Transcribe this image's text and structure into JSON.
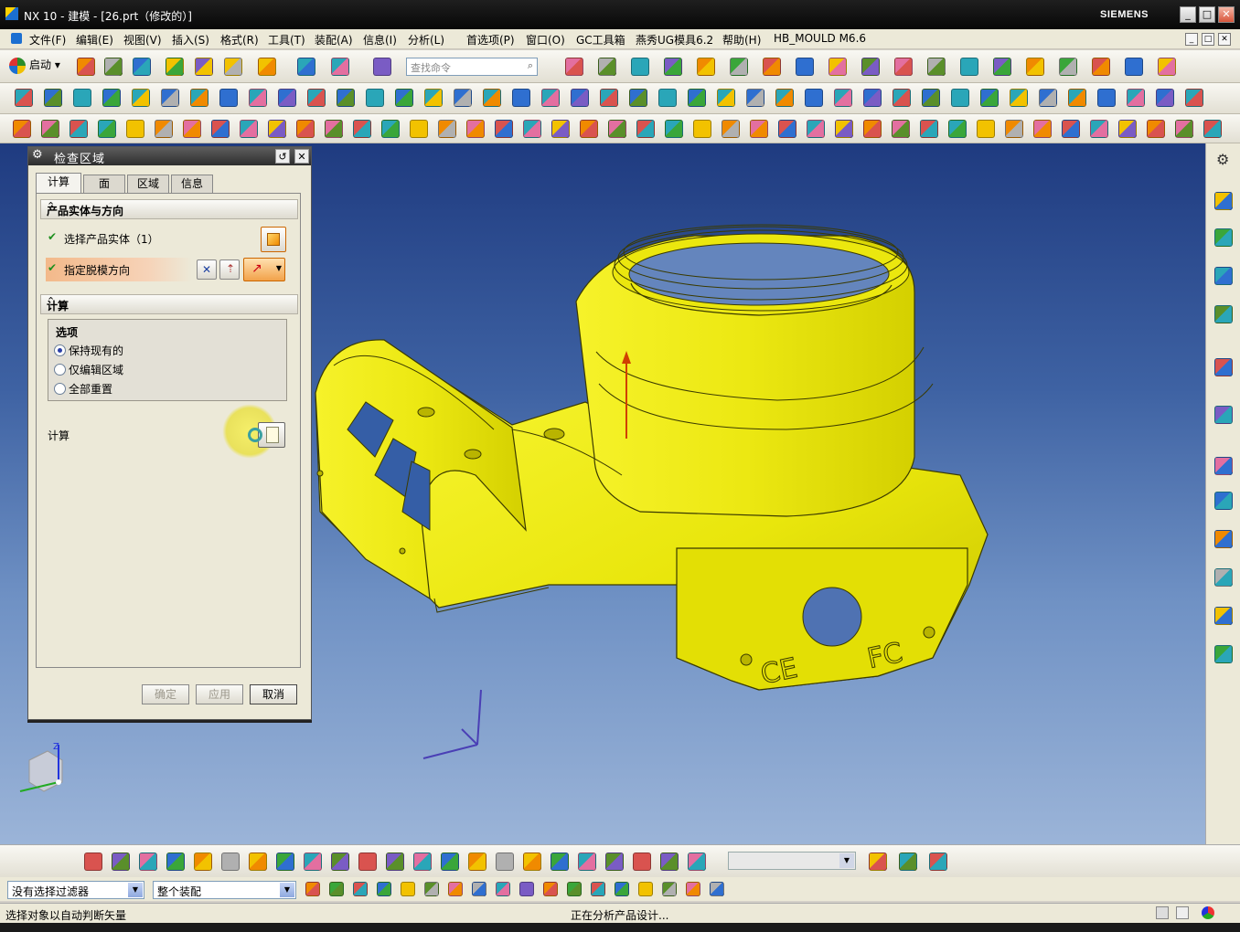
{
  "window": {
    "title": "NX 10 - 建模 - [26.prt（修改的）]",
    "brand": "SIEMENS",
    "controls": [
      "_",
      "□",
      "✕"
    ]
  },
  "menu": {
    "items": [
      "文件(F)",
      "编辑(E)",
      "视图(V)",
      "插入(S)",
      "格式(R)",
      "工具(T)",
      "装配(A)",
      "信息(I)",
      "分析(L)",
      "首选项(P)",
      "窗口(O)",
      "GC工具箱",
      "燕秀UG模具6.2",
      "帮助(H)",
      "HB_MOULD M6.6"
    ]
  },
  "toolbar": {
    "start_label": "启动",
    "search_placeholder": "查找命令"
  },
  "dialog": {
    "title": "检查区域",
    "tabs": [
      "计算",
      "面",
      "区域",
      "信息"
    ],
    "active_tab": "计算",
    "group_product": "产品实体与方向",
    "select_body": "选择产品实体（1）",
    "draft_direction": "指定脱模方向",
    "group_calc": "计算",
    "options_title": "选项",
    "options": [
      "保持现有的",
      "仅编辑区域",
      "全部重置"
    ],
    "selected_option": "保持现有的",
    "calc_label": "计算",
    "ok": "确定",
    "apply": "应用",
    "cancel": "取消"
  },
  "model": {
    "color": "#f2ef12",
    "marks": [
      "CE",
      "FC"
    ]
  },
  "filters": {
    "selection_filter": "没有选择过滤器",
    "scope": "整个装配"
  },
  "status": {
    "left": "选择对象以自动判断矢量",
    "center": "正在分析产品设计..."
  }
}
